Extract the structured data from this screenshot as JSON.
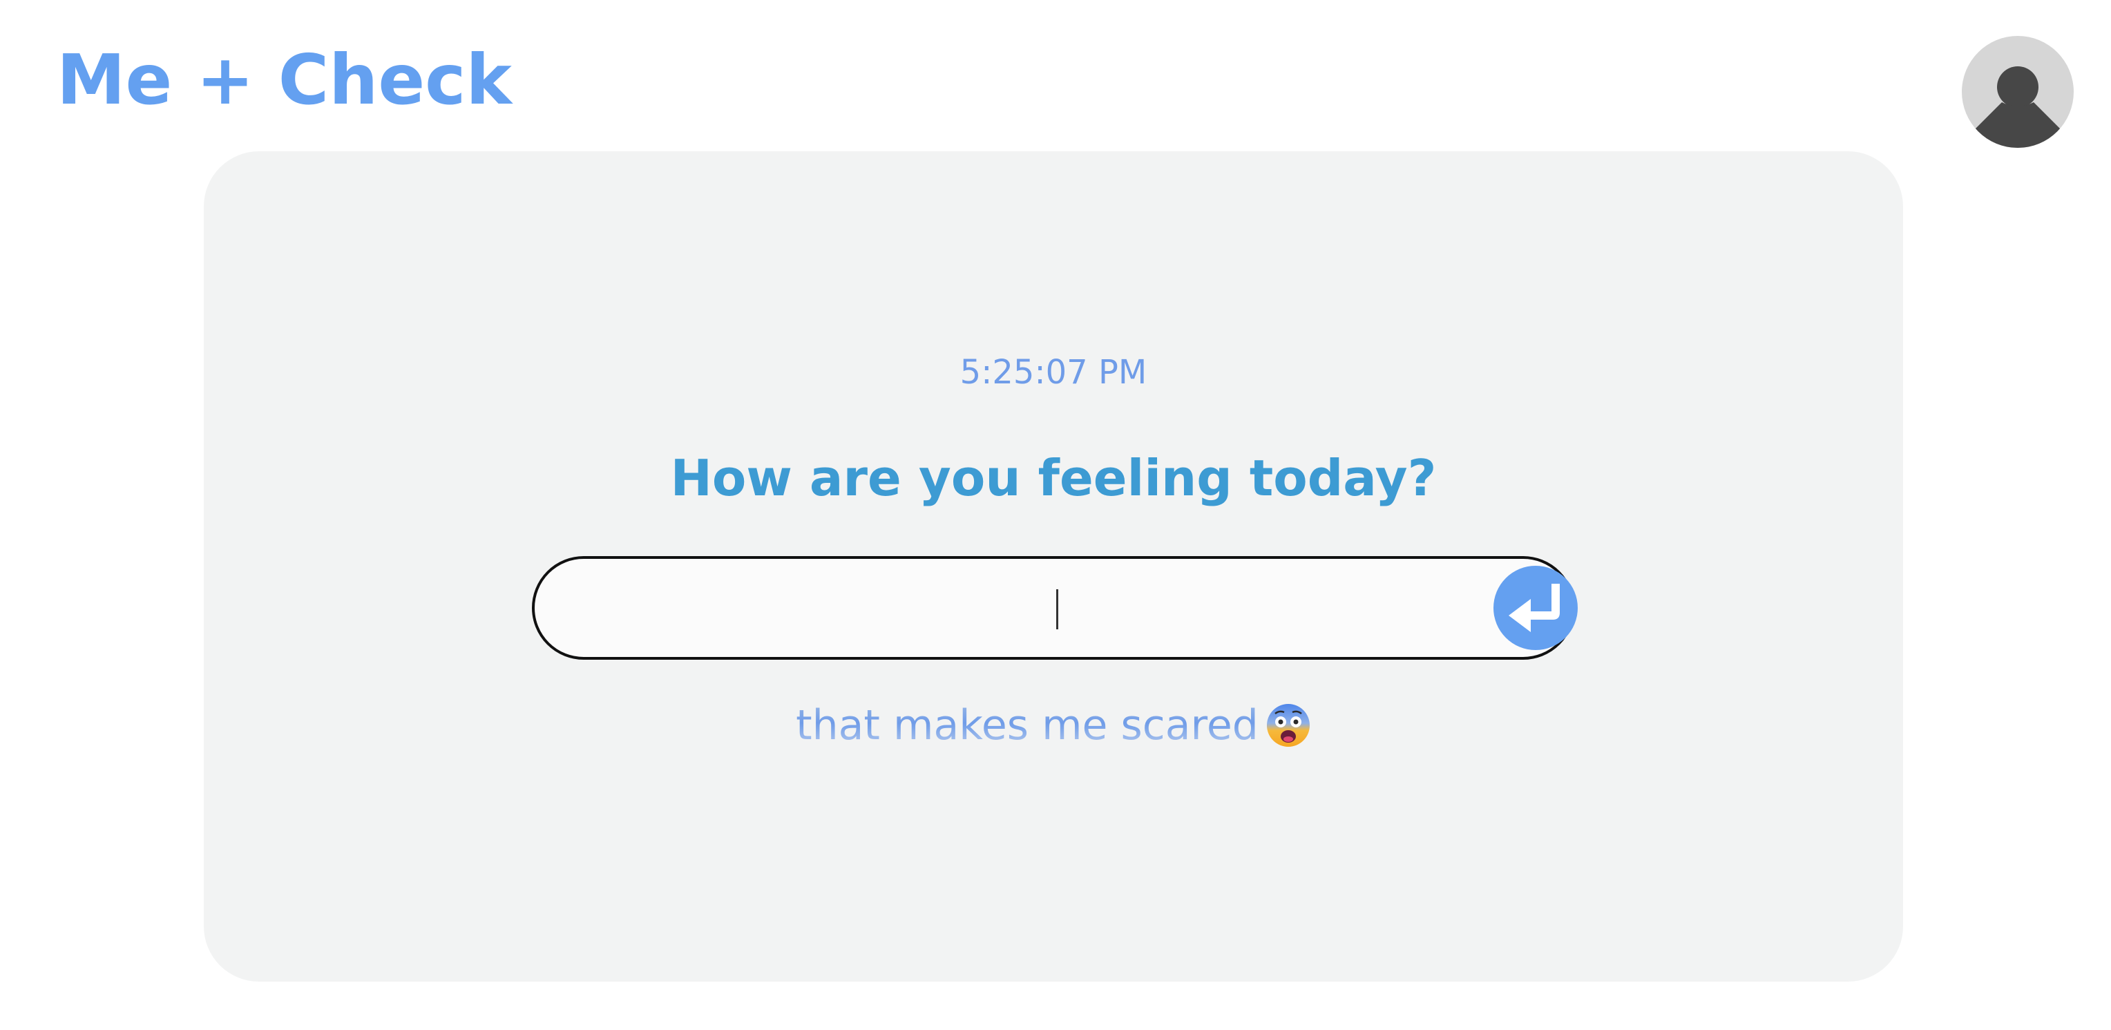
{
  "header": {
    "app_title": "Me + Check"
  },
  "avatar": {
    "icon": "user-silhouette-icon"
  },
  "main": {
    "clock": "5:25:07 PM",
    "question": "How are you feeling today?",
    "input": {
      "value": "",
      "placeholder": ""
    },
    "submit_icon": "enter-return-icon",
    "response_text": "that makes me scared",
    "response_emoji": "fearful-face-emoji"
  },
  "colors": {
    "accent": "#64a0f0",
    "question": "#3d9bd3",
    "card_background": "#f2f3f3",
    "avatar_background": "#d6d6d6"
  }
}
